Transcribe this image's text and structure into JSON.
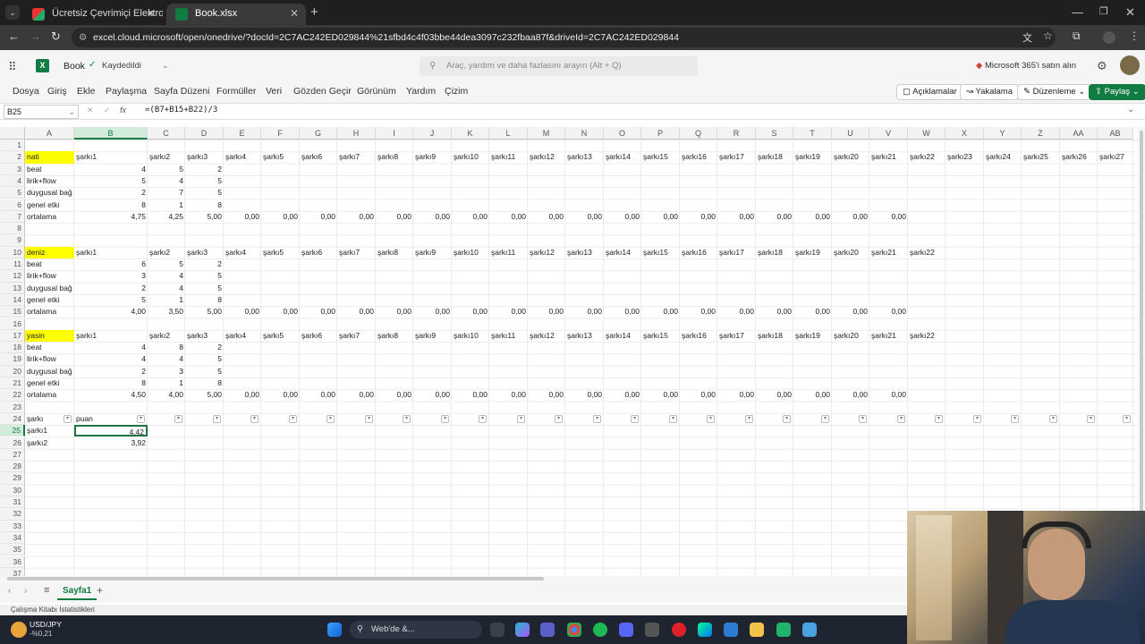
{
  "browser": {
    "tabs": [
      {
        "title": "Ücretsiz Çevrimiçi Elektronik Tab"
      },
      {
        "title": "Book.xlsx"
      }
    ],
    "url": "excel.cloud.microsoft/open/onedrive/?docId=2C7AC242ED029844%21sfbd4c4f03bbe44dea3097c232fbaa87f&driveId=2C7AC242ED029844"
  },
  "app": {
    "doc_name": "Book",
    "save_status": "Kaydedildi",
    "search_placeholder": "Araç, yardım ve daha fazlasını arayın (Alt + Q)",
    "buy_label": "Microsoft 365'i satın alın"
  },
  "menu": {
    "items": [
      "Dosya",
      "Giriş",
      "Ekle",
      "Paylaşma",
      "Sayfa Düzeni",
      "Formüller",
      "Veri",
      "Gözden Geçir",
      "Görünüm",
      "Yardım",
      "Çizim"
    ],
    "comments": "Açıklamalar",
    "catchup": "Yakalama",
    "editing": "Düzenleme",
    "share": "Paylaş"
  },
  "formula_bar": {
    "name_box": "B25",
    "fx": "fx",
    "formula": "=(B7+B15+B22)/3"
  },
  "grid": {
    "columns": [
      "A",
      "B",
      "C",
      "D",
      "E",
      "F",
      "G",
      "H",
      "I",
      "J",
      "K",
      "L",
      "M",
      "N",
      "O",
      "P",
      "Q",
      "R",
      "S",
      "T",
      "U",
      "V",
      "W",
      "X",
      "Y",
      "Z",
      "AA",
      "AB"
    ],
    "rows": [
      "1",
      "2",
      "3",
      "4",
      "5",
      "6",
      "7",
      "8",
      "9",
      "10",
      "11",
      "12",
      "13",
      "14",
      "15",
      "16",
      "17",
      "18",
      "19",
      "20",
      "21",
      "22",
      "23",
      "24",
      "25",
      "26",
      "27",
      "28",
      "29",
      "30",
      "31",
      "32",
      "33",
      "34",
      "35",
      "36",
      "37"
    ],
    "headers_1": [
      "nati",
      "şarkı1",
      "şarkı2",
      "şarkı3",
      "şarkı4",
      "şarkı5",
      "şarkı6",
      "şarkı7",
      "şarkı8",
      "şarkı9",
      "şarkı10",
      "şarkı11",
      "şarkı12",
      "şarkı13",
      "şarkı14",
      "şarkı15",
      "şarkı16",
      "şarkı17",
      "şarkı18",
      "şarkı19",
      "şarkı20",
      "şarkı21",
      "şarkı22",
      "şarkı23",
      "şarkı24",
      "şarkı25",
      "şarkı26",
      "şarkı27"
    ],
    "headers_2": [
      "deniz",
      "şarkı1",
      "şarkı2",
      "şarkı3",
      "şarkı4",
      "şarkı5",
      "şarkı6",
      "şarkı7",
      "şarkı8",
      "şarkı9",
      "şarkı10",
      "şarkı11",
      "şarkı12",
      "şarkı13",
      "şarkı14",
      "şarkı15",
      "şarkı16",
      "şarkı17",
      "şarkı18",
      "şarkı19",
      "şarkı20",
      "şarkı21",
      "şarkı22"
    ],
    "headers_3": [
      "yasin",
      "şarkı1",
      "şarkı2",
      "şarkı3",
      "şarkı4",
      "şarkı5",
      "şarkı6",
      "şarkı7",
      "şarkı8",
      "şarkı9",
      "şarkı10",
      "şarkı11",
      "şarkı12",
      "şarkı13",
      "şarkı14",
      "şarkı15",
      "şarkı16",
      "şarkı17",
      "şarkı18",
      "şarkı19",
      "şarkı20",
      "şarkı21",
      "şarkı22"
    ],
    "criteria": [
      "beat",
      "lirik+flow",
      "duygusal bağ",
      "genel etki",
      "ortalama"
    ],
    "block1": [
      [
        "4",
        "5",
        "2"
      ],
      [
        "5",
        "4",
        "5"
      ],
      [
        "2",
        "7",
        "5"
      ],
      [
        "8",
        "1",
        "8"
      ]
    ],
    "avg1": [
      "4,75",
      "4,25",
      "5,00",
      "0,00",
      "0,00",
      "0,00",
      "0,00",
      "0,00",
      "0,00",
      "0,00",
      "0,00",
      "0,00",
      "0,00",
      "0,00",
      "0,00",
      "0,00",
      "0,00",
      "0,00",
      "0,00",
      "0,00",
      "0,00"
    ],
    "block2": [
      [
        "6",
        "5",
        "2"
      ],
      [
        "3",
        "4",
        "5"
      ],
      [
        "2",
        "4",
        "5"
      ],
      [
        "5",
        "1",
        "8"
      ]
    ],
    "avg2": [
      "4,00",
      "3,50",
      "5,00",
      "0,00",
      "0,00",
      "0,00",
      "0,00",
      "0,00",
      "0,00",
      "0,00",
      "0,00",
      "0,00",
      "0,00",
      "0,00",
      "0,00",
      "0,00",
      "0,00",
      "0,00",
      "0,00",
      "0,00",
      "0,00"
    ],
    "block3": [
      [
        "4",
        "8",
        "2"
      ],
      [
        "4",
        "4",
        "5"
      ],
      [
        "2",
        "3",
        "5"
      ],
      [
        "8",
        "1",
        "8"
      ]
    ],
    "avg3": [
      "4,50",
      "4,00",
      "5,00",
      "0,00",
      "0,00",
      "0,00",
      "0,00",
      "0,00",
      "0,00",
      "0,00",
      "0,00",
      "0,00",
      "0,00",
      "0,00",
      "0,00",
      "0,00",
      "0,00",
      "0,00",
      "0,00",
      "0,00",
      "0,00"
    ],
    "table_headers": [
      "şarkı",
      "puan"
    ],
    "table_rows": [
      [
        "şarkı1",
        "4,42"
      ],
      [
        "şarkı2",
        "3,92"
      ]
    ]
  },
  "sheets": {
    "active": "Sayfa1"
  },
  "status": {
    "text": "Çalışma Kitabı İstatistikleri"
  },
  "taskbar": {
    "search": "Web'de &...",
    "ticker": "USD/JPY",
    "change": "-%0,21"
  },
  "colors": {
    "highlight": "#ffff00",
    "excel_green": "#107c41",
    "selected": "#217346"
  }
}
